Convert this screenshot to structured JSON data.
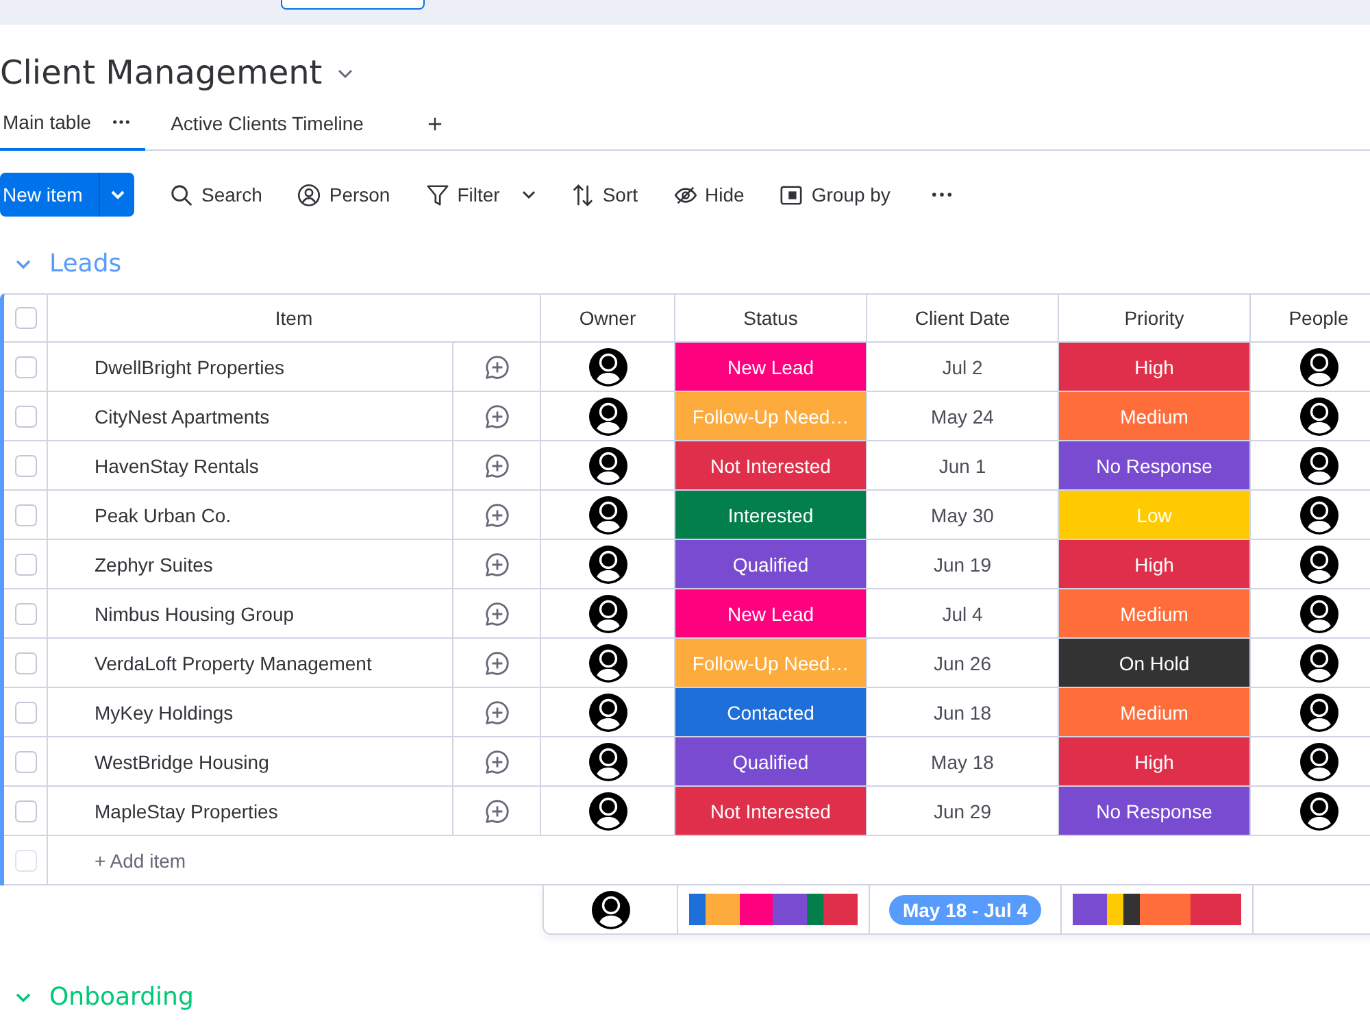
{
  "board": {
    "title": "Client Management"
  },
  "views": [
    {
      "label": "Main table",
      "selected": true
    },
    {
      "label": "Active Clients Timeline",
      "selected": false
    }
  ],
  "toolbar": {
    "primary": "New item",
    "actions": [
      {
        "kind": "search",
        "label": "Search"
      },
      {
        "kind": "person",
        "label": "Person"
      },
      {
        "kind": "filter",
        "label": "Filter"
      },
      {
        "kind": "sort",
        "label": "Sort"
      },
      {
        "kind": "hide",
        "label": "Hide"
      },
      {
        "kind": "group",
        "label": "Group by"
      }
    ]
  },
  "groups": [
    {
      "title": "Leads",
      "color": "#579bfc",
      "expanded": true,
      "columns": [
        "Item",
        "Owner",
        "Status",
        "Client Date",
        "Priority",
        "People"
      ],
      "select_all": {
        "checked": false
      },
      "rows": [
        {
          "item": "DwellBright Properties",
          "checked": false,
          "status": {
            "label": "New Lead",
            "color": "#ff007f"
          },
          "date": "Jul 2",
          "priority": {
            "label": "High",
            "color": "#df2f4a"
          }
        },
        {
          "item": "CityNest Apartments",
          "checked": false,
          "status": {
            "label": "Follow-Up Need…",
            "color": "#fdab3d"
          },
          "date": "May 24",
          "priority": {
            "label": "Medium",
            "color": "#ff6d3b"
          }
        },
        {
          "item": "HavenStay Rentals",
          "checked": false,
          "status": {
            "label": "Not Interested",
            "color": "#df2f4a"
          },
          "date": "Jun 1",
          "priority": {
            "label": "No Response",
            "color": "#784bd1"
          }
        },
        {
          "item": "Peak Urban Co.",
          "checked": false,
          "status": {
            "label": "Interested",
            "color": "#037f4c"
          },
          "date": "May 30",
          "priority": {
            "label": "Low",
            "color": "#ffcb00"
          }
        },
        {
          "item": "Zephyr Suites",
          "checked": false,
          "status": {
            "label": "Qualified",
            "color": "#784bd1"
          },
          "date": "Jun 19",
          "priority": {
            "label": "High",
            "color": "#df2f4a"
          }
        },
        {
          "item": "Nimbus Housing Group",
          "checked": false,
          "status": {
            "label": "New Lead",
            "color": "#ff007f"
          },
          "date": "Jul 4",
          "priority": {
            "label": "Medium",
            "color": "#ff6d3b"
          }
        },
        {
          "item": "VerdaLoft Property Management",
          "checked": false,
          "status": {
            "label": "Follow-Up Need…",
            "color": "#fdab3d"
          },
          "date": "Jun 26",
          "priority": {
            "label": "On Hold",
            "color": "#333333"
          }
        },
        {
          "item": "MyKey Holdings",
          "checked": false,
          "status": {
            "label": "Contacted",
            "color": "#1f6fdb"
          },
          "date": "Jun 18",
          "priority": {
            "label": "Medium",
            "color": "#ff6d3b"
          }
        },
        {
          "item": "WestBridge Housing",
          "checked": false,
          "status": {
            "label": "Qualified",
            "color": "#784bd1"
          },
          "date": "May 18",
          "priority": {
            "label": "High",
            "color": "#df2f4a"
          }
        },
        {
          "item": "MapleStay Properties",
          "checked": false,
          "status": {
            "label": "Not Interested",
            "color": "#df2f4a"
          },
          "date": "Jun 29",
          "priority": {
            "label": "No Response",
            "color": "#784bd1"
          }
        }
      ],
      "add_item": {
        "label": "+ Add item",
        "checked": false,
        "disabled": true
      },
      "summary": {
        "status_segments": [
          {
            "color": "#1f6fdb"
          },
          {
            "color": "#fdab3d"
          },
          {
            "color": "#ff007f"
          },
          {
            "color": "#784bd1"
          },
          {
            "color": "#037f4c"
          },
          {
            "color": "#df2f4a"
          }
        ],
        "date_range": "May 18 - Jul 4",
        "priority_segments": [
          {
            "color": "#784bd1"
          },
          {
            "color": "#ffcb00"
          },
          {
            "color": "#333333"
          },
          {
            "color": "#ff6d3b"
          },
          {
            "color": "#df2f4a"
          }
        ]
      }
    },
    {
      "title": "Onboarding",
      "color": "#00c875",
      "expanded": true
    }
  ]
}
